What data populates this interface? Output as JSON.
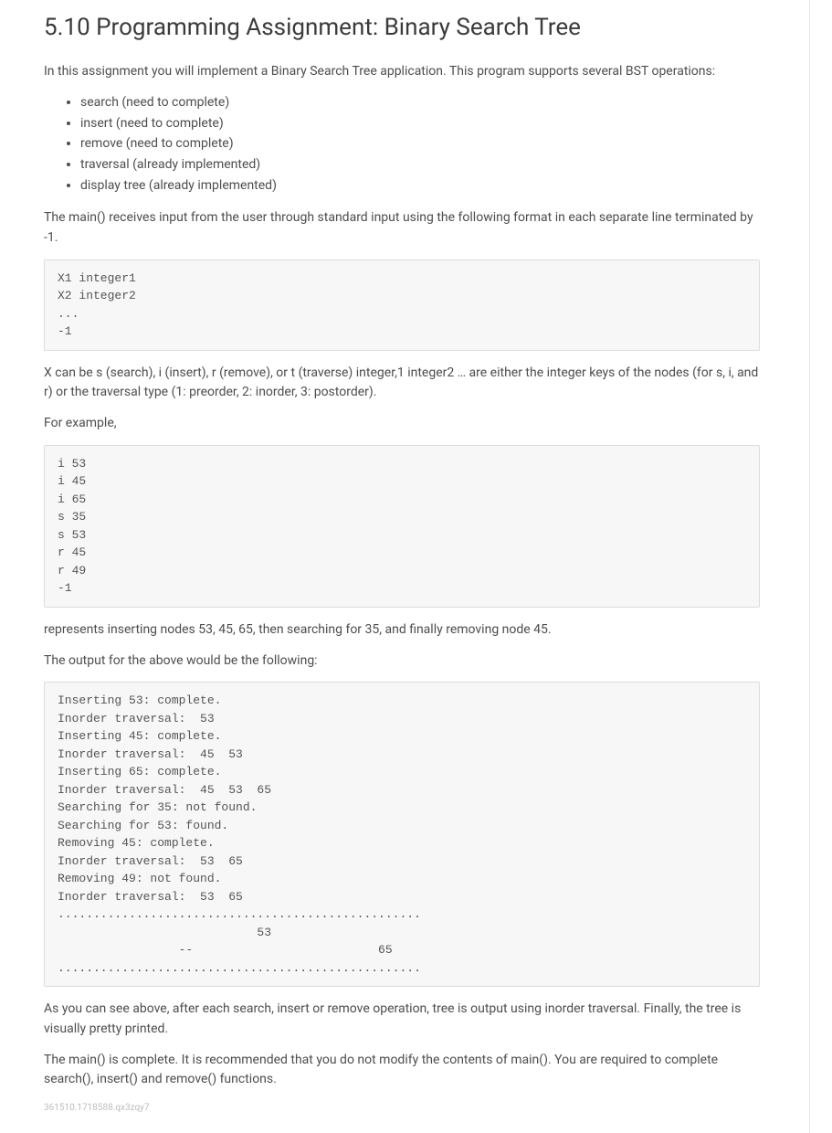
{
  "title": "5.10 Programming Assignment: Binary Search Tree",
  "intro": "In this assignment you will implement a Binary Search Tree application. This program supports several BST operations:",
  "operations": [
    "search (need to complete)",
    "insert (need to complete)",
    "remove (need to complete)",
    "traversal (already implemented)",
    "display tree (already implemented)"
  ],
  "main_input_desc": "The main() receives input from the user through standard input using the following format in each separate line terminated by -1.",
  "code_format": "X1 integer1\nX2 integer2\n...\n-1",
  "x_explain": "X can be s (search), i (insert), r (remove), or t (traverse) integer,1 integer2 … are either the integer keys of the nodes (for s, i, and r) or the traversal type (1: preorder, 2: inorder, 3: postorder).",
  "for_example": "For example,",
  "code_example_input": "i 53\ni 45\ni 65\ns 35\ns 53\nr 45\nr 49\n-1",
  "example_explain": "represents inserting nodes 53, 45, 65, then searching for 35, and finally removing node 45.",
  "output_intro": "The output for the above would be the following:",
  "code_example_output": "Inserting 53: complete.\nInorder traversal:  53\nInserting 45: complete.\nInorder traversal:  45  53\nInserting 65: complete.\nInorder traversal:  45  53  65\nSearching for 35: not found.\nSearching for 53: found.\nRemoving 45: complete.\nInorder traversal:  53  65\nRemoving 49: not found.\nInorder traversal:  53  65\n...................................................\n                            53\n                 --                          65\n...................................................",
  "after_output": "As you can see above, after each search, insert or remove operation, tree is output using inorder traversal. Finally, the tree is visually pretty printed.",
  "main_complete": "The main() is complete. It is recommended that you do not modify the contents of main(). You are required to complete search(), insert() and remove() functions.",
  "footer_code": "361510.1718588.qx3zqy7"
}
